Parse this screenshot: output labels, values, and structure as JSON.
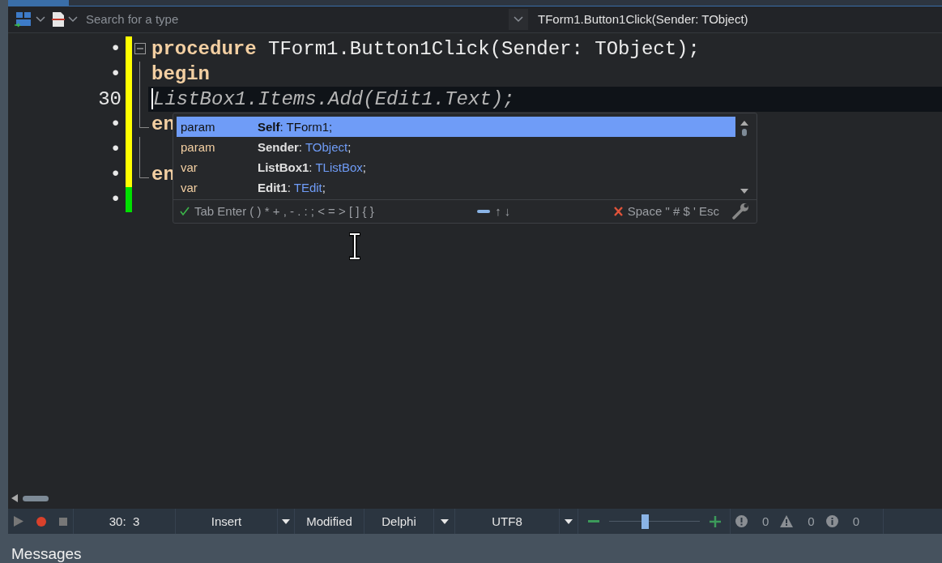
{
  "toolbar": {
    "search": {
      "placeholder": "Search for a type"
    },
    "method": "TForm1.Button1Click(Sender: TObject)"
  },
  "editor": {
    "lines": [
      {
        "gutter": "•",
        "color": "#ffff00",
        "current": false,
        "kind": "foldstart",
        "segments": [
          {
            "kind": "keyword",
            "text": "procedure"
          },
          {
            "kind": "plain",
            "text": " TForm1.Button1Click(Sender: TObject);"
          }
        ]
      },
      {
        "gutter": "•",
        "color": "#ffff00",
        "current": false,
        "kind": "foldbody",
        "segments": [
          {
            "kind": "keyword",
            "text": "begin"
          }
        ]
      },
      {
        "gutter": "30",
        "color": "#ffff00",
        "current": true,
        "kind": "foldbody",
        "segments": [
          {
            "kind": "ghost",
            "text": "ListBox1.Items.Add(Edit1.Text);"
          }
        ]
      },
      {
        "gutter": "•",
        "color": "#ffff00",
        "current": false,
        "kind": "foldend",
        "segments": [
          {
            "kind": "keyword",
            "text": "en"
          }
        ]
      },
      {
        "gutter": "•",
        "color": "#ffff00",
        "current": false,
        "kind": "foldbody"
      },
      {
        "gutter": "•",
        "color": "#ffff00",
        "current": false,
        "kind": "foldend",
        "segments": [
          {
            "kind": "keyword",
            "text": "en"
          }
        ]
      },
      {
        "gutter": "•",
        "color": "#00e000",
        "current": false,
        "kind": "plain"
      }
    ]
  },
  "completion": {
    "items": [
      {
        "kind": "param",
        "name": "Self",
        "separator": ": ",
        "type": "TForm1",
        "terminator": ";",
        "selected": true
      },
      {
        "kind": "param",
        "name": "Sender",
        "separator": ": ",
        "type": "TObject",
        "terminator": ";",
        "selected": false
      },
      {
        "kind": "var",
        "name": "ListBox1",
        "separator": ": ",
        "type": "TListBox",
        "terminator": ";",
        "selected": false
      },
      {
        "kind": "var",
        "name": "Edit1",
        "separator": ": ",
        "type": "TEdit",
        "terminator": ";",
        "selected": false
      }
    ],
    "accept_keys": "Tab Enter ( ) * + , - . : ; < = > [ ] { }",
    "navigate_keys": "↑ ↓",
    "cancel_keys": "Space \" # $ ' Esc"
  },
  "status_bar": {
    "position": "30:  3",
    "mode": "Insert",
    "state": "Modified",
    "language": "Delphi",
    "encoding": "UTF8",
    "zoom": {
      "level": 0.4
    },
    "errors": "0",
    "warnings": "0",
    "hints": "0"
  },
  "messages": {
    "title": "Messages"
  }
}
